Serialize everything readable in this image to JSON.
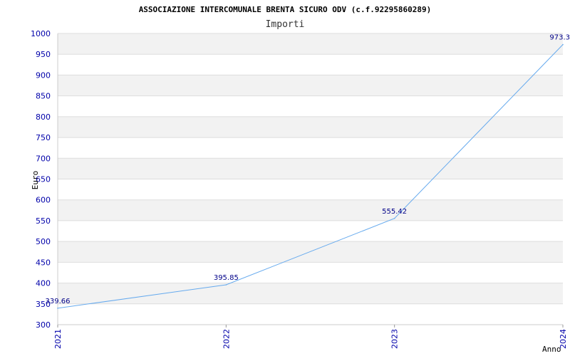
{
  "chart_data": {
    "type": "line",
    "title": "ASSOCIAZIONE INTERCOMUNALE BRENTA SICURO ODV (c.f.92295860289)",
    "subtitle": "Importi",
    "xlabel": "Anno",
    "ylabel": "Euro",
    "categories": [
      "2021",
      "2022",
      "2023",
      "2024"
    ],
    "series": [
      {
        "values": [
          339.66,
          395.85,
          555.42,
          973.3
        ],
        "value_labels": [
          "339.66",
          "395.85",
          "555.42",
          "973.3"
        ]
      }
    ],
    "ylim": [
      300,
      1000
    ],
    "yticks": [
      "300",
      "350",
      "400",
      "450",
      "500",
      "550",
      "600",
      "650",
      "700",
      "750",
      "800",
      "850",
      "900",
      "950",
      "1000"
    ],
    "grid": true,
    "colors": {
      "line": "#66aaee",
      "tick_text": "#0000aa",
      "band": "#f2f2f2",
      "gridline": "#dddddd"
    }
  }
}
